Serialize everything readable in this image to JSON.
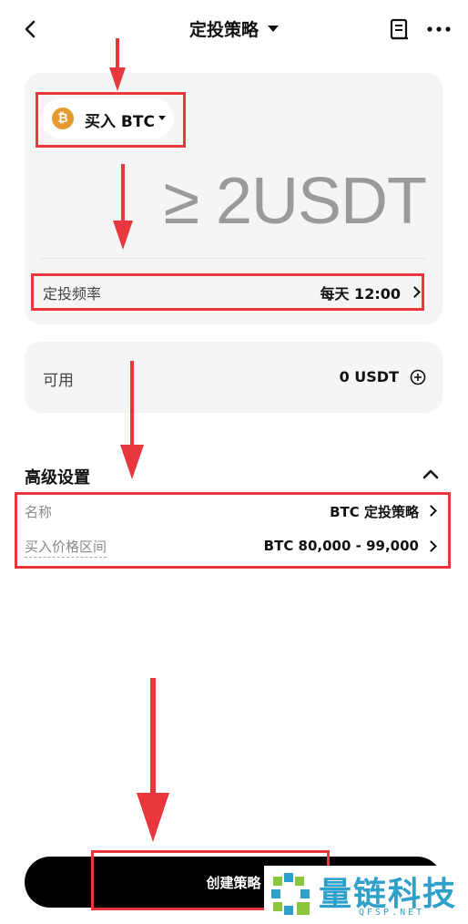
{
  "header": {
    "title": "定投策略"
  },
  "strategy": {
    "coin_label": "买入 BTC",
    "coin_symbol": "₿",
    "amount_text": "≥ 2USDT",
    "frequency_label": "定投频率",
    "frequency_value": "每天 12:00"
  },
  "balance": {
    "label": "可用",
    "value": "0 USDT"
  },
  "advanced": {
    "title": "高级设置",
    "rows": [
      {
        "label": "名称",
        "value": "BTC 定投策略"
      },
      {
        "label": "买入价格区间",
        "value": "BTC 80,000 - 99,000"
      }
    ]
  },
  "footer": {
    "button_label": "创建策略"
  },
  "watermark": {
    "brand": "量链科技",
    "domain": "QFSP.NET"
  },
  "colors": {
    "accent_red": "#e8383d",
    "btc_orange": "#e59a2f",
    "button_black": "#000000",
    "watermark_blue": "#2fa0c9"
  },
  "icons": [
    "chevron-left-icon",
    "caret-down-icon",
    "document-icon",
    "more-icon",
    "btc-icon",
    "chevron-right-icon",
    "plus-circle-icon",
    "chevron-up-icon"
  ]
}
